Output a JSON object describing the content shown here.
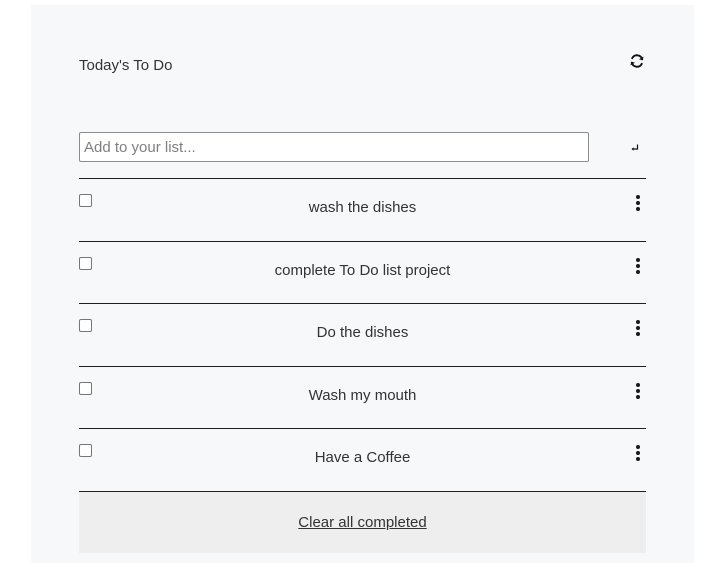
{
  "header": {
    "title": "Today's To Do",
    "refresh_icon": "refresh-icon"
  },
  "add": {
    "placeholder": "Add to your list...",
    "value": "",
    "enter_icon": "enter-icon"
  },
  "items": [
    {
      "label": "wash the dishes",
      "completed": false
    },
    {
      "label": "complete To Do list project",
      "completed": false
    },
    {
      "label": "Do the dishes",
      "completed": false
    },
    {
      "label": "Wash my mouth",
      "completed": false
    },
    {
      "label": "Have a Coffee",
      "completed": false
    }
  ],
  "footer": {
    "clear_label": "Clear all completed"
  },
  "colors": {
    "card_background": "#f7f8fa",
    "footer_background": "#eeeeee",
    "divider": "#1f1f1f"
  }
}
